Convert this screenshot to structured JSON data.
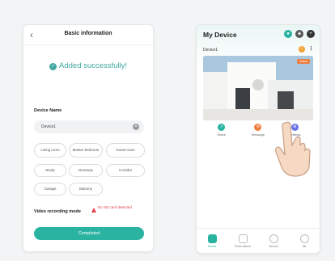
{
  "left": {
    "header_title": "Basic information",
    "back_icon": "chevron-left-icon",
    "success_text": "Added successfully!",
    "device_name_label": "Device Name",
    "device_name_value": "Device1",
    "rooms": [
      "Living room",
      "Master bedroom",
      "Guest room",
      "Study",
      "Doorway",
      "Corridor",
      "Garage",
      "Balcony"
    ],
    "video_recording_label": "Video recording mode",
    "sd_warning": "No SD card detected",
    "completed_button": "Completed",
    "accent_color": "#2bb3a2"
  },
  "right": {
    "title": "My Device",
    "device_label": "Device1",
    "camera_badge": "Online",
    "actions": [
      "Share",
      "Message",
      "Settings"
    ],
    "nav": [
      "Device",
      "Photo Album",
      "Service",
      "Me"
    ],
    "active_nav": "Device"
  }
}
